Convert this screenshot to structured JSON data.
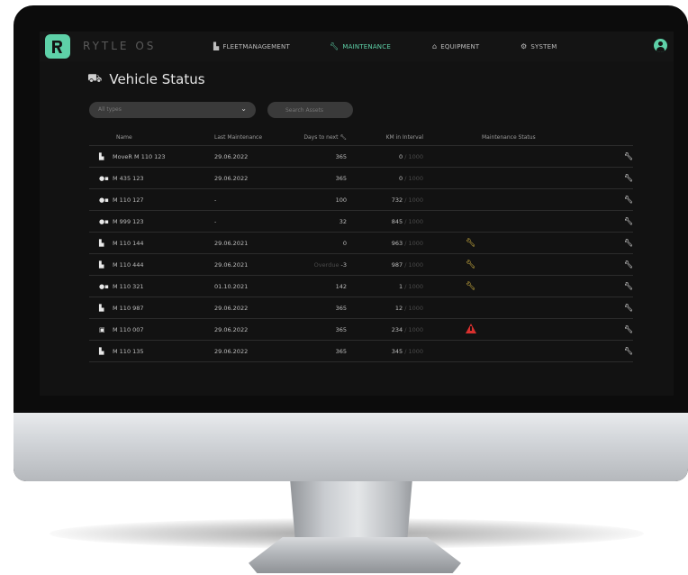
{
  "app": {
    "brand": "RYTLE OS",
    "page_title": "Vehicle Status",
    "accent": "#5ed1a8",
    "warning_color": "#e8c547",
    "alert_color": "#d9302e"
  },
  "nav": [
    {
      "label": "FLEETMANAGEMENT",
      "icon": "fleet-icon",
      "active": false
    },
    {
      "label": "MAINTENANCE",
      "icon": "wrench-icon",
      "active": true
    },
    {
      "label": "EQUIPMENT",
      "icon": "equipment-icon",
      "active": false
    },
    {
      "label": "SYSTEM",
      "icon": "gear-icon",
      "active": false
    }
  ],
  "filters": {
    "select_value": "All types",
    "search_placeholder": "Search Assets"
  },
  "table": {
    "headers": [
      "Name",
      "Last Maintenance",
      "Days to next",
      "KM in Interval",
      "Maintenance Status"
    ],
    "rows": [
      {
        "icon": "box-icon",
        "name": "MoveR M 110 123",
        "last": "29.06.2022",
        "days": "365",
        "km": "0",
        "km_interval": "1000",
        "status": "none"
      },
      {
        "icon": "bike-icon",
        "name": "M 435 123",
        "last": "29.06.2022",
        "days": "365",
        "km": "0",
        "km_interval": "1000",
        "status": "none"
      },
      {
        "icon": "bike-icon",
        "name": "M 110 127",
        "last": "-",
        "days": "100",
        "km": "732",
        "km_interval": "1000",
        "status": "none"
      },
      {
        "icon": "bike-icon",
        "name": "M 999 123",
        "last": "-",
        "days": "32",
        "km": "845",
        "km_interval": "1000",
        "status": "none"
      },
      {
        "icon": "box-icon",
        "name": "M 110 144",
        "last": "29.06.2021",
        "days": "0",
        "km": "963",
        "km_interval": "1000",
        "status": "warning"
      },
      {
        "icon": "box-icon",
        "name": "M 110 444",
        "last": "29.06.2021",
        "days_prefix": "Overdue",
        "days": "-3",
        "km": "987",
        "km_interval": "1000",
        "status": "warning"
      },
      {
        "icon": "bike-icon",
        "name": "M 110 321",
        "last": "01.10.2021",
        "days": "142",
        "km": "1",
        "km_interval": "1000",
        "status": "warning"
      },
      {
        "icon": "box-icon",
        "name": "M 110 987",
        "last": "29.06.2022",
        "days": "365",
        "km": "12",
        "km_interval": "1000",
        "status": "none"
      },
      {
        "icon": "trailer-icon",
        "name": "M 110 007",
        "last": "29.06.2022",
        "days": "365",
        "km": "234",
        "km_interval": "1000",
        "status": "alert"
      },
      {
        "icon": "box-icon",
        "name": "M 110 135",
        "last": "29.06.2022",
        "days": "365",
        "km": "345",
        "km_interval": "1000",
        "status": "none"
      }
    ]
  }
}
